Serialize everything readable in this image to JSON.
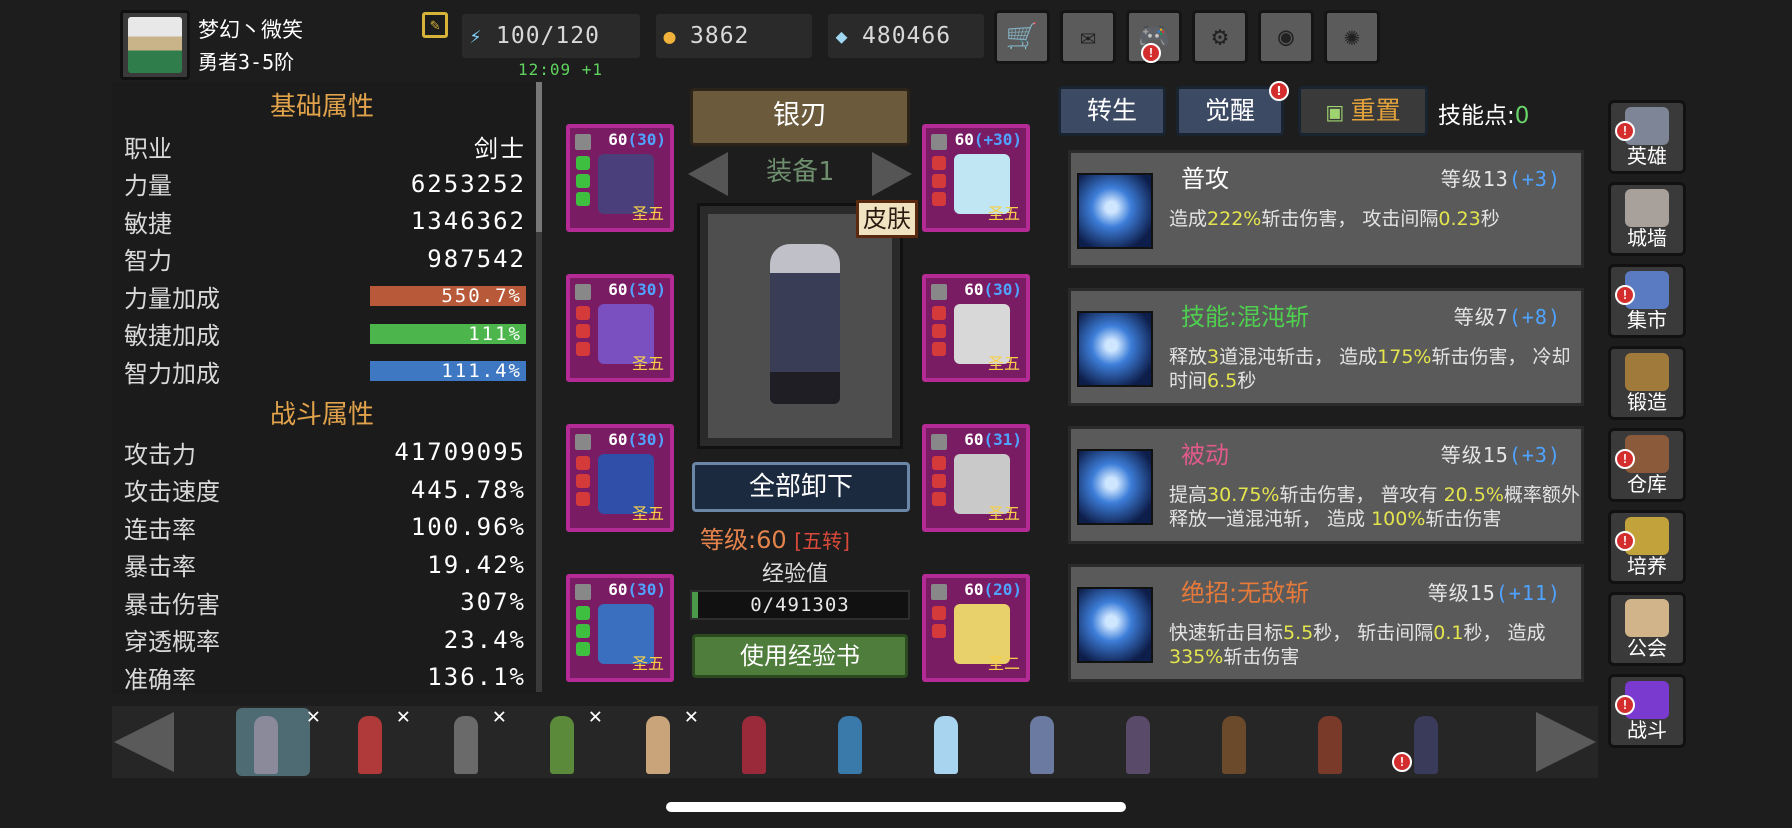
{
  "player": {
    "name": "梦幻丶微笑",
    "rank": "勇者3-5阶"
  },
  "resources": {
    "energy": "100/120",
    "energy_timer": "12:09 +1",
    "gold": "3862",
    "diamonds": "480466"
  },
  "top_buttons": [
    {
      "icon": "cart-icon",
      "glyph": "🛒"
    },
    {
      "icon": "mail-icon",
      "glyph": "✉"
    },
    {
      "icon": "gamepad-icon",
      "glyph": "🎮",
      "alert": "!"
    },
    {
      "icon": "gear-icon",
      "glyph": "⚙"
    },
    {
      "icon": "color-wheel-icon",
      "glyph": "◉"
    },
    {
      "icon": "fireworks-icon",
      "glyph": "✺"
    }
  ],
  "basic_attributes": {
    "title": "基础属性",
    "rows": [
      {
        "label": "职业",
        "value": "剑士"
      },
      {
        "label": "力量",
        "value": "6253252"
      },
      {
        "label": "敏捷",
        "value": "1346362"
      },
      {
        "label": "智力",
        "value": "987542"
      }
    ],
    "bonus_rows": [
      {
        "label": "力量加成",
        "value": "550.7%",
        "color": "#b85a3a"
      },
      {
        "label": "敏捷加成",
        "value": "111%",
        "color": "#4cb54c"
      },
      {
        "label": "智力加成",
        "value": "111.4%",
        "color": "#3f78c2"
      }
    ]
  },
  "combat_attributes": {
    "title": "战斗属性",
    "rows": [
      {
        "label": "攻击力",
        "value": "41709095"
      },
      {
        "label": "攻击速度",
        "value": "445.78%"
      },
      {
        "label": "连击率",
        "value": "100.96%"
      },
      {
        "label": "暴击率",
        "value": "19.42%"
      },
      {
        "label": "暴击伤害",
        "value": "307%"
      },
      {
        "label": "穿透概率",
        "value": "23.4%"
      },
      {
        "label": "准确率",
        "value": "136.1%"
      }
    ]
  },
  "equipment": {
    "weapon_name": "银刃",
    "set_label": "装备1",
    "skin_label": "皮肤",
    "unequip_all": "全部卸下",
    "level_label": "等级:60",
    "reincarnation": "[五转]",
    "exp_label": "经验值",
    "exp_value": "0/491303",
    "use_exp_book": "使用经验书",
    "slots": [
      {
        "level": "60",
        "bonus": "(30)",
        "tier": "圣五",
        "color": "#4a3f7a",
        "gems": [
          "#3fbf3f",
          "#3fbf3f",
          "#3fbf3f"
        ]
      },
      {
        "level": "60",
        "bonus": "(30)",
        "tier": "圣五",
        "color": "#7a4fbf",
        "gems": [
          "#d43a3a",
          "#d43a3a",
          "#d43a3a"
        ]
      },
      {
        "level": "60",
        "bonus": "(30)",
        "tier": "圣五",
        "color": "#2f4fa8",
        "gems": [
          "#d43a3a",
          "#d43a3a",
          "#d43a3a"
        ]
      },
      {
        "level": "60",
        "bonus": "(30)",
        "tier": "圣五",
        "color": "#3a6fbf",
        "gems": [
          "#3fbf3f",
          "#3fbf3f",
          "#3fbf3f"
        ]
      },
      {
        "level": "60",
        "bonus": "(+30)",
        "tier": "圣五",
        "color": "#bfe6f2",
        "gems": [
          "#d43a3a",
          "#d43a3a",
          "#d43a3a"
        ]
      },
      {
        "level": "60",
        "bonus": "(30)",
        "tier": "圣五",
        "color": "#d8d8d8",
        "gems": [
          "#d43a3a",
          "#d43a3a",
          "#d43a3a"
        ]
      },
      {
        "level": "60",
        "bonus": "(31)",
        "tier": "圣五",
        "color": "#c9c9c9",
        "gems": [
          "#d43a3a",
          "#d43a3a",
          "#d43a3a"
        ]
      },
      {
        "level": "60",
        "bonus": "(20)",
        "tier": "圣二",
        "color": "#e8d06a",
        "gems": [
          "#d43a3a",
          "#d43a3a"
        ]
      }
    ]
  },
  "skills_header": {
    "rebirth": "转生",
    "awaken": "觉醒",
    "reset": "重置",
    "skill_points_label": "技能点:",
    "skill_points": "0"
  },
  "skills": [
    {
      "name": "普攻",
      "name_color": "#ffffff",
      "level": "等级13",
      "bonus": "(+3)",
      "desc": [
        [
          "造成",
          ""
        ],
        [
          "222%",
          "b"
        ],
        [
          "斩击伤害， 攻击间隔",
          ""
        ],
        [
          "0.23",
          "b"
        ],
        [
          "秒",
          ""
        ]
      ]
    },
    {
      "name": "技能:混沌斩",
      "name_color": "#4fcf4f",
      "level": "等级7",
      "bonus": "(+8)",
      "desc": [
        [
          "释放",
          ""
        ],
        [
          "3",
          "b"
        ],
        [
          "道混沌斩击， 造成",
          ""
        ],
        [
          "175%",
          "b"
        ],
        [
          "斩击伤害， 冷却时间",
          ""
        ],
        [
          "6.5",
          "b"
        ],
        [
          "秒",
          ""
        ]
      ]
    },
    {
      "name": "被动",
      "name_color": "#e05a8a",
      "level": "等级15",
      "bonus": "(+3)",
      "desc": [
        [
          "提高",
          ""
        ],
        [
          "30.75%",
          "b"
        ],
        [
          "斩击伤害， 普攻有 ",
          ""
        ],
        [
          "20.5%",
          "b"
        ],
        [
          "概率额外释放一道混沌斩， 造成 ",
          ""
        ],
        [
          "100%",
          "b"
        ],
        [
          "斩击伤害",
          ""
        ]
      ]
    },
    {
      "name": "绝招:无敌斩",
      "name_color": "#e67a3a",
      "level": "等级15",
      "bonus": "(+11)",
      "desc": [
        [
          "快速斩击目标",
          ""
        ],
        [
          "5.5",
          "b"
        ],
        [
          "秒， 斩击间隔",
          ""
        ],
        [
          "0.1",
          "b"
        ],
        [
          "秒， 造成",
          ""
        ],
        [
          "335%",
          "b"
        ],
        [
          "斩击伤害",
          ""
        ]
      ]
    }
  ],
  "side_nav": [
    {
      "label": "英雄",
      "icon": "helmet-icon",
      "color": "#7d8596",
      "alert": true
    },
    {
      "label": "城墙",
      "icon": "wall-icon",
      "color": "#a8a09a",
      "alert": false
    },
    {
      "label": "集市",
      "icon": "market-icon",
      "color": "#5a7ac2",
      "alert": true
    },
    {
      "label": "锻造",
      "icon": "anvil-icon",
      "color": "#a07a3a",
      "alert": false
    },
    {
      "label": "仓库",
      "icon": "chest-icon",
      "color": "#8a5a3a",
      "alert": true
    },
    {
      "label": "培养",
      "icon": "chalice-icon",
      "color": "#c2a23a",
      "alert": true
    },
    {
      "label": "公会",
      "icon": "guild-icon",
      "color": "#d2b48a",
      "alert": false
    },
    {
      "label": "战斗",
      "icon": "portal-icon",
      "color": "#7a3acf",
      "alert": true
    }
  ],
  "roster": [
    {
      "color": "#8a8a9a",
      "selected": true,
      "removable": true
    },
    {
      "color": "#b03a3a",
      "selected": false,
      "removable": true
    },
    {
      "color": "#6a6a6a",
      "selected": false,
      "removable": true
    },
    {
      "color": "#5a8a3a",
      "selected": false,
      "removable": true
    },
    {
      "color": "#c9a47a",
      "selected": false,
      "removable": true
    },
    {
      "color": "#9a2a3a",
      "selected": false,
      "removable": false
    },
    {
      "color": "#3a7aaa",
      "selected": false,
      "removable": false
    },
    {
      "color": "#a8d4ef",
      "selected": false,
      "removable": false
    },
    {
      "color": "#6a7aa0",
      "selected": false,
      "removable": false
    },
    {
      "color": "#5a4a6a",
      "selected": false,
      "removable": false
    },
    {
      "color": "#6a4a2a",
      "selected": false,
      "removable": false
    },
    {
      "color": "#7a3a2a",
      "selected": false,
      "removable": false
    },
    {
      "color": "#3a3a5a",
      "selected": false,
      "removable": false,
      "alert": true
    }
  ]
}
